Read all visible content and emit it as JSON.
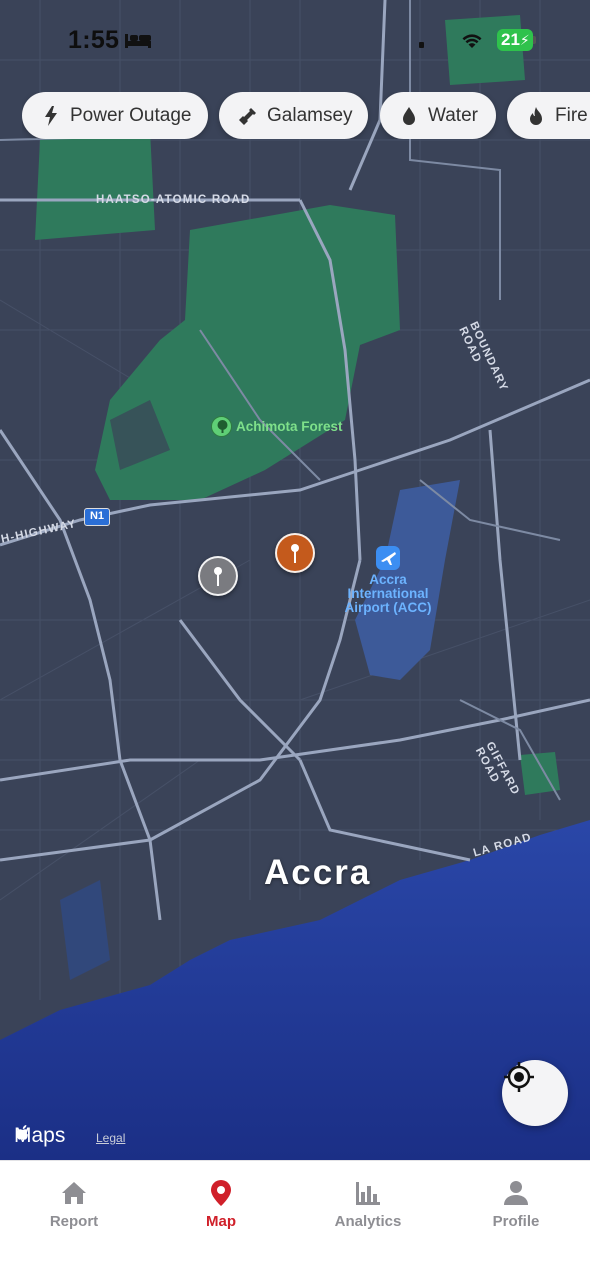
{
  "status_bar": {
    "time": "1:55",
    "battery": "21"
  },
  "filters": [
    {
      "label": "Power Outage",
      "icon": "bolt-icon"
    },
    {
      "label": "Galamsey",
      "icon": "shovel-icon"
    },
    {
      "label": "Water",
      "icon": "water-drop-icon"
    },
    {
      "label": "Fire",
      "icon": "flame-icon"
    }
  ],
  "map": {
    "roads": {
      "haatso": "HAATSO-ATOMIC ROAD",
      "boundary": "BOUNDARY ROAD",
      "highway": "H-HIGHWAY",
      "n1": "N1",
      "giffard": "GIFFARD ROAD",
      "la": "LA ROAD"
    },
    "poi": {
      "forest": "Achimota Forest",
      "airport": "Accra International Airport (ACC)",
      "city": "Accra"
    },
    "pins": [
      {
        "status_color": "#7a7b80"
      },
      {
        "status_color": "#c45a1c"
      }
    ],
    "brand": "Maps",
    "legal": "Legal"
  },
  "tabs": [
    {
      "label": "Report",
      "icon": "home-icon",
      "active": false
    },
    {
      "label": "Map",
      "icon": "map-pin-icon",
      "active": true
    },
    {
      "label": "Analytics",
      "icon": "bar-chart-icon",
      "active": false
    },
    {
      "label": "Profile",
      "icon": "person-icon",
      "active": false
    }
  ],
  "colors": {
    "accent": "#d0202a",
    "map_land": "#3a4358",
    "sea": "#1f3b9a",
    "park": "#2f7a5c"
  }
}
